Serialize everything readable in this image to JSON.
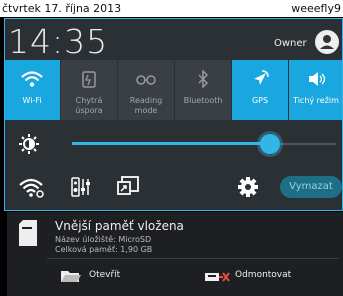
{
  "status_bar": {
    "date": "čtvrtek 17. října 2013",
    "carrier": "weeefly9"
  },
  "header": {
    "time": "14:35",
    "user": "Owner"
  },
  "tiles": [
    {
      "label": "Wi-Fi",
      "icon": "wifi-icon",
      "active": true
    },
    {
      "label": "Chytrá\núspora",
      "icon": "smart-saving-icon",
      "active": false
    },
    {
      "label": "Reading\nmode",
      "icon": "glasses-icon",
      "active": false
    },
    {
      "label": "Bluetooth",
      "icon": "bluetooth-icon",
      "active": false
    },
    {
      "label": "GPS",
      "icon": "gps-icon",
      "active": true
    },
    {
      "label": "Tichý režim",
      "icon": "silent-mode-icon",
      "active": true
    }
  ],
  "brightness": {
    "icon": "brightness-icon",
    "level": 0.75
  },
  "bottom_row": {
    "clear_label": "Vymazat"
  },
  "notification": {
    "title": "Vnější paměť vložena",
    "line1": "Název úložiště: MicroSD",
    "line2": "Celková paměť: 1,90 GB",
    "action_open": "Otevřít",
    "action_unmount": "Odmontovat"
  },
  "colors": {
    "accent": "#33b5e5",
    "tile_active": "#1aa7e0",
    "panel": "#2b3035"
  }
}
